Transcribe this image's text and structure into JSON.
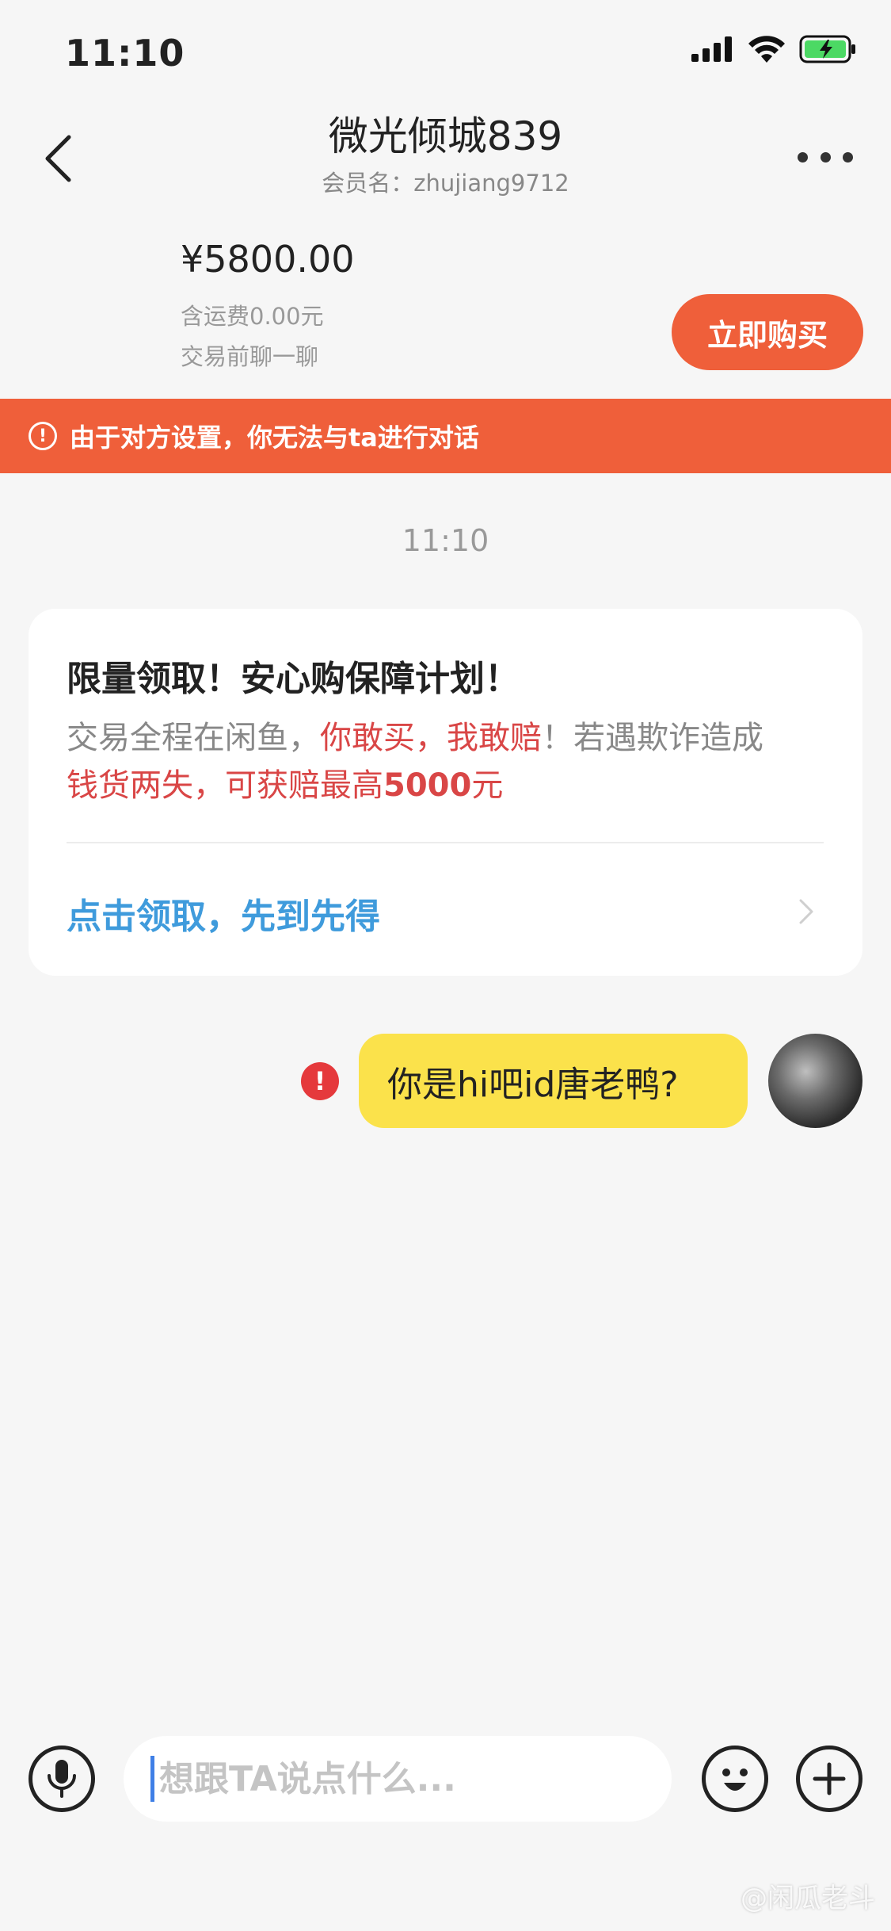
{
  "status_bar": {
    "time": "11:10"
  },
  "header": {
    "title": "微光倾城839",
    "subtitle": "会员名：zhujiang9712"
  },
  "product": {
    "price": "¥5800.00",
    "shipping": "含运费0.00元",
    "note": "交易前聊一聊",
    "buy_label": "立即购买"
  },
  "warning": {
    "text": "由于对方设置，你无法与ta进行对话"
  },
  "chat": {
    "time": "11:10"
  },
  "promo_card": {
    "title": "限量领取！安心购保障计划！",
    "line1_a": "交易全程在闲鱼，",
    "line1_b": "你敢买，我敢赔",
    "line1_c": "！若遇欺诈造成",
    "line2_a": "钱货两失，可获赔最高",
    "line2_b": "5000",
    "line2_c": "元",
    "link": "点击领取，先到先得"
  },
  "message": {
    "text": "你是hi吧id唐老鸭?",
    "status": "!"
  },
  "input": {
    "placeholder": "想跟TA说点什么..."
  },
  "watermark": "@闲瓜老斗",
  "colors": {
    "accent": "#ef5f3a",
    "bubble": "#fbe24b",
    "link": "#3f9bdc",
    "highlight_red": "#d94646",
    "error": "#e5393c"
  },
  "icons": [
    "back-icon",
    "more-icon",
    "signal-icon",
    "wifi-icon",
    "battery-icon",
    "alert-icon",
    "chevron-right-icon",
    "error-icon",
    "mic-icon",
    "emoji-icon",
    "plus-icon"
  ]
}
